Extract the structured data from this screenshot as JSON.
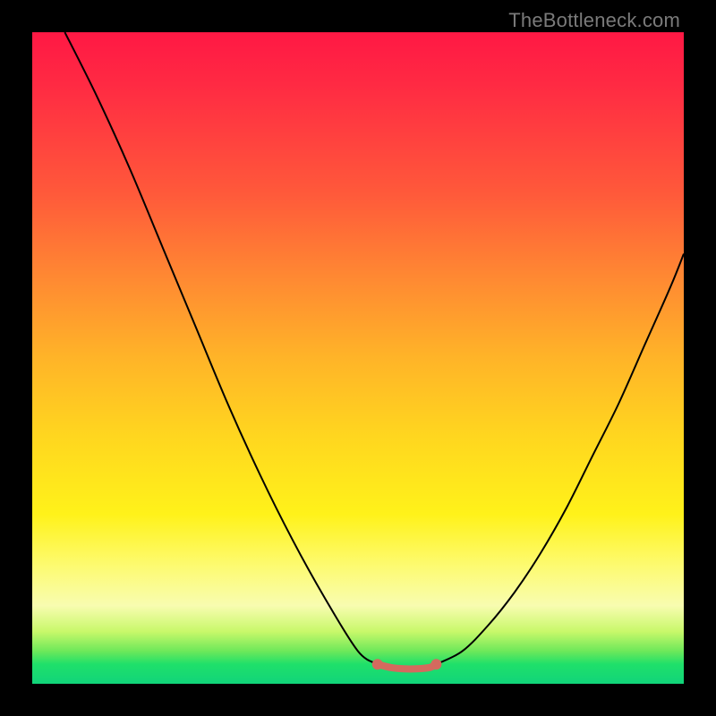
{
  "watermark": "TheBottleneck.com",
  "colors": {
    "background_frame": "#000000",
    "curve": "#000000",
    "threshold_marker": "#d46a5e",
    "gradient_top": "#ff1844",
    "gradient_mid": "#ffd61f",
    "gradient_bottom": "#11d47a"
  },
  "chart_data": {
    "type": "line",
    "title": "",
    "xlabel": "",
    "ylabel": "",
    "x_range": [
      0,
      100
    ],
    "y_range": [
      0,
      100
    ],
    "note": "x/y in percent of plot area; y=0 is bottom (green), y=100 is top (red). Two black curve branches descend into a valley; a short salmon segment marks the flat minimum.",
    "series": [
      {
        "name": "left_branch",
        "x": [
          5,
          10,
          15,
          20,
          25,
          30,
          35,
          40,
          45,
          50,
          53
        ],
        "y": [
          100,
          90,
          79,
          67,
          55,
          43,
          32,
          22,
          13,
          5,
          3
        ]
      },
      {
        "name": "right_branch",
        "x": [
          62,
          66,
          70,
          74,
          78,
          82,
          86,
          90,
          94,
          98,
          100
        ],
        "y": [
          3,
          5,
          9,
          14,
          20,
          27,
          35,
          43,
          52,
          61,
          66
        ]
      },
      {
        "name": "threshold_flat",
        "x": [
          53,
          55,
          57,
          59,
          61,
          62
        ],
        "y": [
          3,
          2.5,
          2.3,
          2.3,
          2.5,
          3
        ]
      }
    ],
    "threshold_endpoints": [
      {
        "x": 53,
        "y": 3
      },
      {
        "x": 62,
        "y": 3
      }
    ]
  }
}
